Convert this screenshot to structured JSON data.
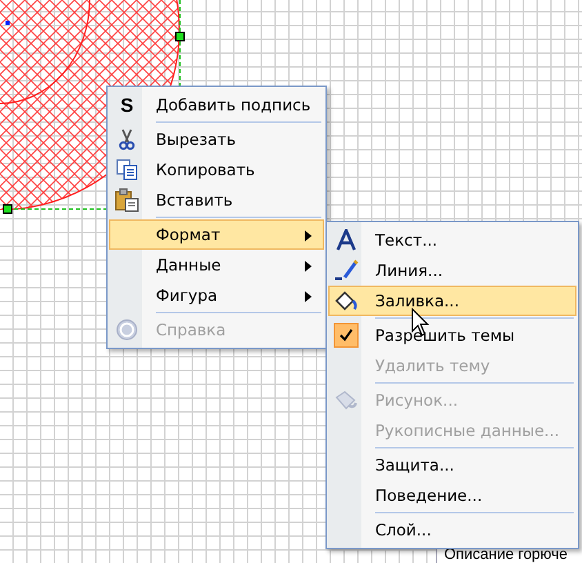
{
  "context_menu": {
    "groups": [
      [
        {
          "label": "Добавить подпись",
          "glyph": "S",
          "selected": false,
          "disabled": false,
          "has_submenu": false
        }
      ],
      [
        {
          "label": "Вырезать",
          "selected": false,
          "disabled": false,
          "has_submenu": false
        },
        {
          "label": "Копировать",
          "selected": false,
          "disabled": false,
          "has_submenu": false
        },
        {
          "label": "Вставить",
          "selected": false,
          "disabled": false,
          "has_submenu": false
        }
      ],
      [
        {
          "label": "Формат",
          "selected": true,
          "disabled": false,
          "has_submenu": true
        },
        {
          "label": "Данные",
          "selected": false,
          "disabled": false,
          "has_submenu": true
        },
        {
          "label": "Фигура",
          "selected": false,
          "disabled": false,
          "has_submenu": true
        }
      ],
      [
        {
          "label": "Справка",
          "selected": false,
          "disabled": true,
          "has_submenu": false
        }
      ]
    ]
  },
  "submenu": {
    "groups": [
      [
        {
          "label": "Текст...",
          "selected": false,
          "disabled": false,
          "checked": false
        },
        {
          "label": "Линия...",
          "selected": false,
          "disabled": false,
          "checked": false
        },
        {
          "label": "Заливка...",
          "selected": true,
          "disabled": false,
          "checked": false
        }
      ],
      [
        {
          "label": "Разрешить темы",
          "selected": false,
          "disabled": false,
          "checked": true
        },
        {
          "label": "Удалить тему",
          "selected": false,
          "disabled": true,
          "checked": false
        }
      ],
      [
        {
          "label": "Рисунок...",
          "selected": false,
          "disabled": true,
          "checked": false
        },
        {
          "label": "Рукописные данные...",
          "selected": false,
          "disabled": true,
          "checked": false
        }
      ],
      [
        {
          "label": "Защита...",
          "selected": false,
          "disabled": false,
          "checked": false
        },
        {
          "label": "Поведение...",
          "selected": false,
          "disabled": false,
          "checked": false
        }
      ],
      [
        {
          "label": "Слой...",
          "selected": false,
          "disabled": false,
          "checked": false
        }
      ]
    ]
  },
  "background_panel": {
    "text": "Описание горюче"
  }
}
